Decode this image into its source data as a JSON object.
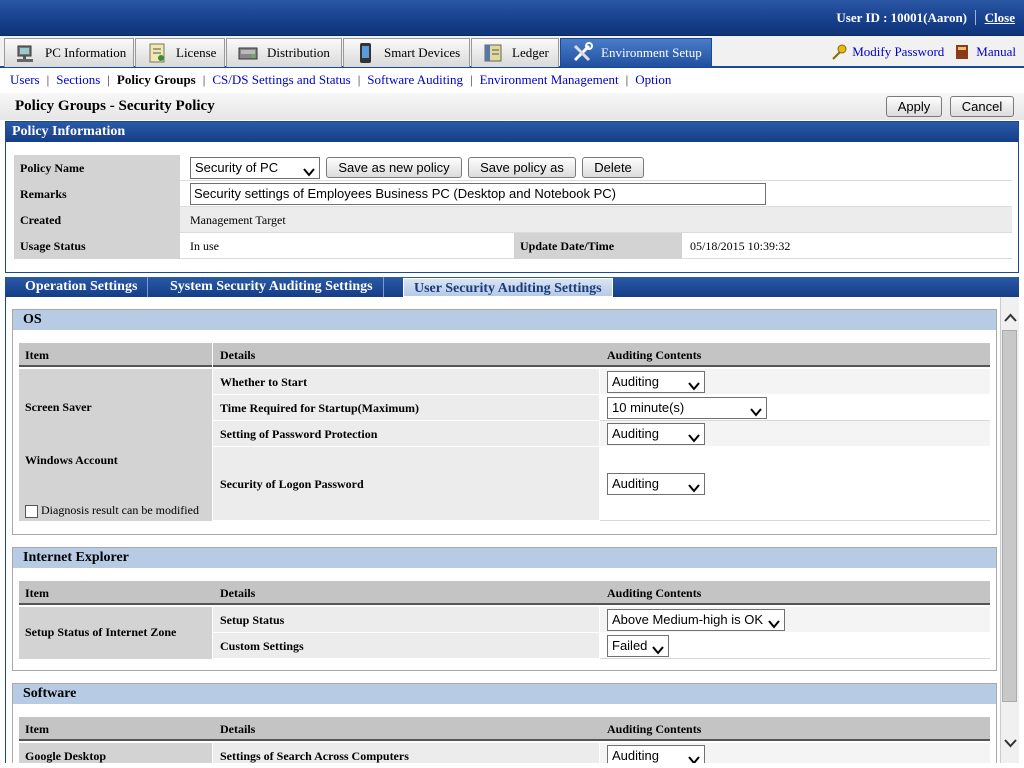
{
  "header": {
    "user_id": "User ID : 10001(Aaron)",
    "close": "Close"
  },
  "main_nav": {
    "tabs": [
      {
        "label": "PC Information",
        "icon": "pc-icon"
      },
      {
        "label": "License",
        "icon": "license-icon"
      },
      {
        "label": "Distribution",
        "icon": "distribution-icon"
      },
      {
        "label": "Smart Devices",
        "icon": "smart-device-icon"
      },
      {
        "label": "Ledger",
        "icon": "ledger-icon"
      },
      {
        "label": "Environment Setup",
        "icon": "tools-icon",
        "active": true
      }
    ],
    "modify_password": "Modify Password",
    "manual": "Manual"
  },
  "sub_nav": {
    "items": [
      "Users",
      "Sections",
      "Policy Groups",
      "CS/DS Settings and Status",
      "Software Auditing",
      "Environment Management",
      "Option"
    ],
    "current": "Policy Groups"
  },
  "page": {
    "title": "Policy Groups - Security Policy",
    "apply": "Apply",
    "cancel": "Cancel"
  },
  "policy_info": {
    "heading": "Policy Information",
    "policy_name_label": "Policy Name",
    "policy_name_value": "Security of PC",
    "save_new": "Save as new policy",
    "save_as": "Save policy as",
    "delete": "Delete",
    "remarks_label": "Remarks",
    "remarks_value": "Security settings of Employees Business PC (Desktop and Notebook PC)",
    "created_label": "Created",
    "created_value": "Management Target",
    "usage_label": "Usage Status",
    "usage_value": "In use",
    "update_label": "Update Date/Time",
    "update_value": "05/18/2015 10:39:32"
  },
  "tabs": [
    "Operation Settings",
    "System Security Auditing Settings",
    "User Security Auditing Settings"
  ],
  "table_headers": {
    "item": "Item",
    "details": "Details",
    "auditing": "Auditing Contents"
  },
  "os": {
    "title": "OS",
    "screen_saver": "Screen Saver",
    "whether_to_start": "Whether to Start",
    "whether_to_start_value": "Auditing",
    "time_required": "Time Required for Startup(Maximum)",
    "time_required_value": "10 minute(s)",
    "password_protection": "Setting of Password Protection",
    "password_protection_value": "Auditing",
    "windows_account": "Windows Account",
    "diagnosis": "Diagnosis result can be modified",
    "logon_password": "Security of Logon Password",
    "logon_password_value": "Auditing"
  },
  "ie": {
    "title": "Internet Explorer",
    "zone": "Setup Status of Internet Zone",
    "setup_status": "Setup Status",
    "setup_status_value": "Above Medium-high is OK",
    "custom": "Custom Settings",
    "custom_value": "Failed"
  },
  "software": {
    "title": "Software",
    "google_desktop": "Google Desktop",
    "search_across": "Settings of Search Across Computers",
    "search_across_value": "Auditing"
  }
}
